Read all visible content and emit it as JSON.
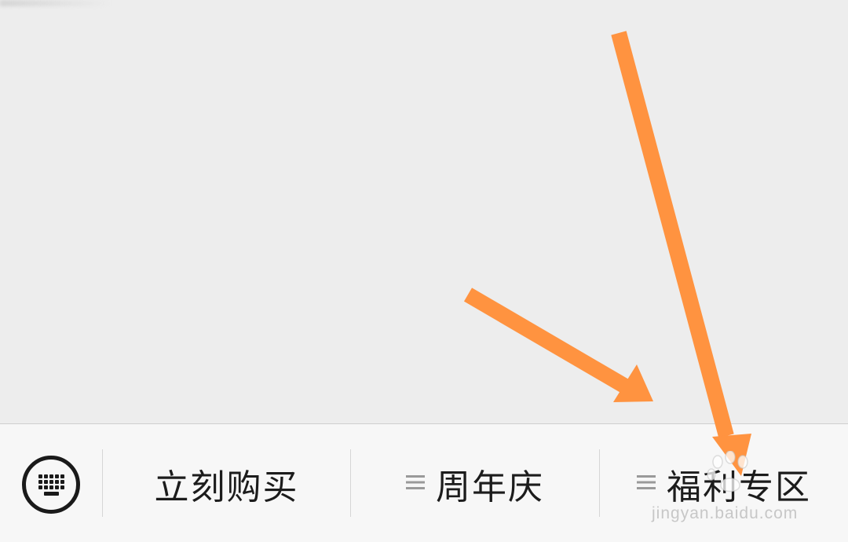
{
  "colors": {
    "background": "#ededed",
    "menu_bar": "#f7f7f7",
    "text": "#1c1c1c",
    "annotation_arrow": "#ff9340"
  },
  "keyboard_toggle": {
    "icon": "keyboard-icon"
  },
  "menu": {
    "items": [
      {
        "label": "立刻购买",
        "has_submenu": false
      },
      {
        "label": "周年庆",
        "has_submenu": true,
        "icon": "submenu-lines-icon"
      },
      {
        "label": "福利专区",
        "has_submenu": true,
        "icon": "submenu-lines-icon"
      }
    ]
  },
  "watermark": {
    "text": "jingyan.baidu.com"
  }
}
